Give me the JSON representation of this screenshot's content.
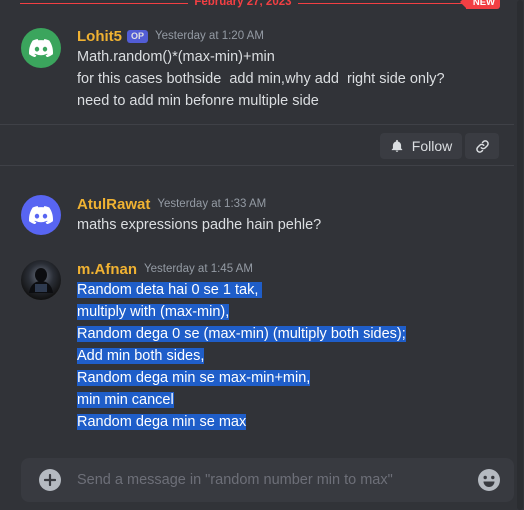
{
  "divider": {
    "date": "February 27, 2023",
    "badge": "NEW"
  },
  "messages": [
    {
      "username": "Lohit5",
      "badge": "OP",
      "timestamp": "Yesterday at 1:20 AM",
      "lines": [
        "Math.random()*(max-min)+min",
        "for this cases bothside  add min,why add  right side only?",
        "need to add min befonre multiple side"
      ]
    },
    {
      "username": "AtulRawat",
      "timestamp": "Yesterday at 1:33 AM",
      "lines": [
        "maths expressions padhe hain pehle?"
      ]
    },
    {
      "username": "m.Afnan",
      "timestamp": "Yesterday at 1:45 AM",
      "lines": [
        "Random deta hai 0 se 1 tak, ",
        "multiply with (max-min),",
        "Random dega 0 se (max-min) (multiply both sides);",
        "Add min both sides,",
        "Random dega min se max-min+min,",
        "min min cancel",
        "Random dega min se max"
      ]
    }
  ],
  "thread": {
    "follow_label": "Follow"
  },
  "composer": {
    "placeholder": "Send a message in \"random number min to max\""
  },
  "icons": {
    "avatar_1": "discord-logo-icon",
    "avatar_2": "discord-logo-icon",
    "follow": "bell-icon",
    "link": "link-icon",
    "add": "plus-circle-icon",
    "emoji": "emoji-icon"
  },
  "colors": {
    "username": "#f0b232",
    "accent_red": "#f23f43",
    "blurple": "#5865f2",
    "green": "#3ba55d",
    "selection": "#1f5ec9"
  }
}
